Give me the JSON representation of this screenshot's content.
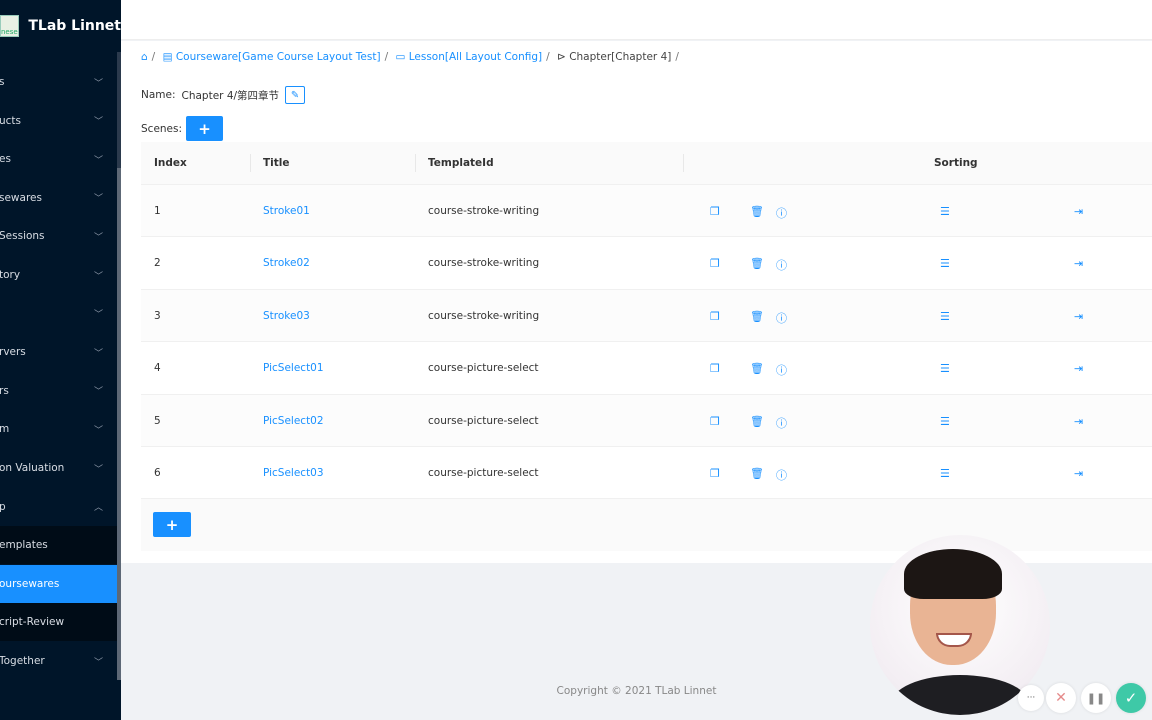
{
  "app": {
    "title": "TLab Linnet",
    "logo_text": "nese"
  },
  "sidebar": {
    "items": [
      {
        "label": "s",
        "chevron": "down"
      },
      {
        "label": "ucts",
        "chevron": "down"
      },
      {
        "label": "es",
        "chevron": "down"
      },
      {
        "label": "sewares",
        "chevron": "down"
      },
      {
        "label": "Sessions",
        "chevron": "down"
      },
      {
        "label": "tory",
        "chevron": "down"
      },
      {
        "label": "",
        "chevron": "down"
      },
      {
        "label": "rvers",
        "chevron": "down"
      },
      {
        "label": "rs",
        "chevron": "down"
      },
      {
        "label": "m",
        "chevron": "down"
      },
      {
        "label": "on Valuation",
        "chevron": "down"
      },
      {
        "label": "p",
        "chevron": "up"
      },
      {
        "label": "emplates",
        "sub": true
      },
      {
        "label": "oursewares",
        "sub": true,
        "active": true
      },
      {
        "label": "cript-Review",
        "sub": true
      },
      {
        "label": "Together",
        "chevron": "down"
      }
    ]
  },
  "breadcrumb": {
    "items": [
      "Courseware[Game Course Layout Test]",
      "Lesson[All Layout Config]",
      "Chapter[Chapter 4]"
    ]
  },
  "name": {
    "label": "Name:",
    "value": "Chapter 4/第四章节"
  },
  "scenes": {
    "label": "Scenes:",
    "add": "+"
  },
  "table": {
    "headers": [
      "Index",
      "Title",
      "TemplateId",
      "Sorting"
    ],
    "rows": [
      {
        "index": "1",
        "title": "Stroke01",
        "template": "course-stroke-writing"
      },
      {
        "index": "2",
        "title": "Stroke02",
        "template": "course-stroke-writing"
      },
      {
        "index": "3",
        "title": "Stroke03",
        "template": "course-stroke-writing"
      },
      {
        "index": "4",
        "title": "PicSelect01",
        "template": "course-picture-select"
      },
      {
        "index": "5",
        "title": "PicSelect02",
        "template": "course-picture-select"
      },
      {
        "index": "6",
        "title": "PicSelect03",
        "template": "course-picture-select"
      }
    ],
    "add": "+"
  },
  "footer": {
    "copyright": "Copyright © 2021 TLab Linnet"
  },
  "controls": {
    "more": "···",
    "close": "✕",
    "pause": "❚❚",
    "confirm": "✓"
  },
  "colors": {
    "accent": "#1890ff",
    "sidebar": "#001529",
    "confirm": "#3ec9a7"
  }
}
